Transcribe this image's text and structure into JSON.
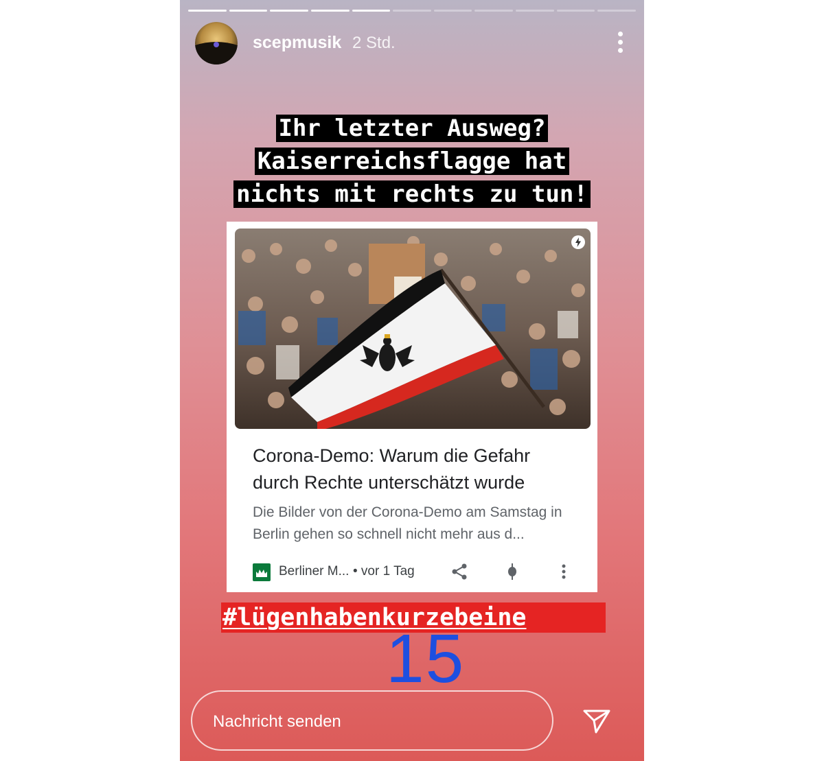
{
  "story": {
    "username": "scepmusik",
    "time": "2 Std.",
    "progress_total": 11,
    "progress_done": 5,
    "caption_lines": [
      "Ihr letzter Ausweg?",
      "Kaiserreichsflagge hat",
      "nichts mit rechts zu tun!"
    ],
    "hashtag": "#lügenhabenkurzebeine",
    "counter": "15",
    "reply_placeholder": "Nachricht senden"
  },
  "card": {
    "headline": "Corona-Demo: Warum die Gefahr durch Rechte unterschätzt wurde",
    "snippet": "Die Bilder von der Corona-Demo am Samstag in Berlin gehen so schnell nicht mehr aus d...",
    "source": "Berliner M...",
    "age": "• vor 1 Tag"
  },
  "icons": {
    "more": "more-vertical-icon",
    "amp": "lightning-icon",
    "share": "share-icon",
    "pin": "location-pin-icon",
    "kebab": "more-vertical-icon",
    "send": "send-icon"
  },
  "colors": {
    "hashtag_bg": "#e52423",
    "counter": "#1d4fe0",
    "source_logo": "#0b7a3b"
  }
}
